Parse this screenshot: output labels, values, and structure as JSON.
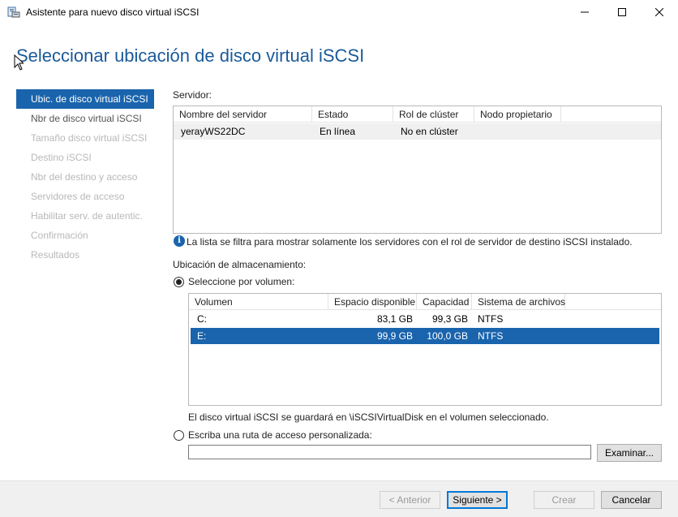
{
  "window": {
    "title": "Asistente para nuevo disco virtual iSCSI",
    "minimize_glyph": "—",
    "maximize_glyph": "□",
    "close_glyph": "✕"
  },
  "page": {
    "heading": "Seleccionar ubicación de disco virtual iSCSI"
  },
  "nav": {
    "items": [
      {
        "label": "Ubic. de disco virtual iSCSI",
        "state": "active"
      },
      {
        "label": "Nbr de disco virtual iSCSI",
        "state": "available"
      },
      {
        "label": "Tamaño disco virtual iSCSI",
        "state": "disabled"
      },
      {
        "label": "Destino iSCSI",
        "state": "disabled"
      },
      {
        "label": "Nbr del destino y acceso",
        "state": "disabled"
      },
      {
        "label": "Servidores de acceso",
        "state": "disabled"
      },
      {
        "label": "Habilitar serv. de autentic.",
        "state": "disabled"
      },
      {
        "label": "Confirmación",
        "state": "disabled"
      },
      {
        "label": "Resultados",
        "state": "disabled"
      }
    ]
  },
  "server_section": {
    "label": "Servidor:",
    "columns": [
      "Nombre del servidor",
      "Estado",
      "Rol de clúster",
      "Nodo propietario"
    ],
    "rows": [
      {
        "name": "yerayWS22DC",
        "status": "En línea",
        "cluster_role": "No en clúster",
        "owner_node": ""
      }
    ],
    "info_text": "La lista se filtra para mostrar solamente los servidores con el rol de servidor de destino iSCSI instalado."
  },
  "storage_section": {
    "label": "Ubicación de almacenamiento:",
    "by_volume_label": "Seleccione por volumen:",
    "by_volume_selected": true,
    "columns": [
      "Volumen",
      "Espacio disponible",
      "Capacidad",
      "Sistema de archivos"
    ],
    "rows": [
      {
        "volume": "C:",
        "free": "83,1 GB",
        "capacity": "99,3 GB",
        "fs": "NTFS",
        "selected": false
      },
      {
        "volume": "E:",
        "free": "99,9 GB",
        "capacity": "100,0 GB",
        "fs": "NTFS",
        "selected": true
      }
    ],
    "note": "El disco virtual iSCSI se guardará en \\iSCSIVirtualDisk en el volumen seleccionado.",
    "custom_path_label": "Escriba una ruta de acceso personalizada:",
    "custom_path_value": "",
    "browse_label": "Examinar..."
  },
  "footer": {
    "previous_label": "< Anterior",
    "next_label": "Siguiente >",
    "create_label": "Crear",
    "cancel_label": "Cancelar"
  },
  "colors": {
    "accent": "#1a64ad",
    "heading": "#1a5a9a"
  }
}
